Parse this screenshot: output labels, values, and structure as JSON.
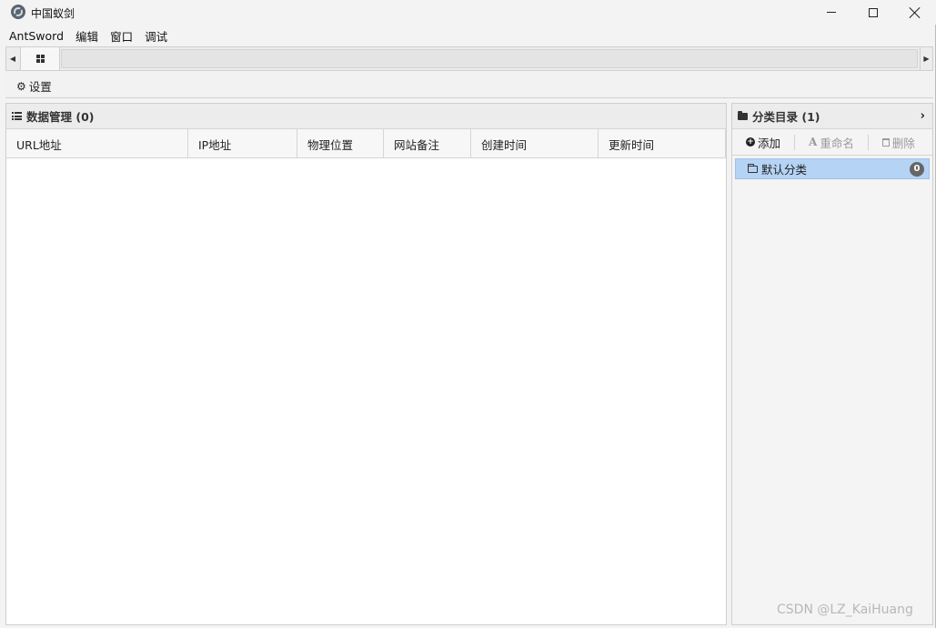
{
  "window": {
    "title": "中国蚁剑"
  },
  "menubar": {
    "items": [
      "AntSword",
      "编辑",
      "窗口",
      "调试"
    ]
  },
  "toolbar": {
    "settings_label": "设置"
  },
  "data_panel": {
    "title": "数据管理 (0)",
    "columns": [
      "URL地址",
      "IP地址",
      "物理位置",
      "网站备注",
      "创建时间",
      "更新时间"
    ],
    "rows": []
  },
  "category_panel": {
    "title": "分类目录 (1)",
    "actions": {
      "add": "添加",
      "rename": "重命名",
      "delete": "删除"
    },
    "items": [
      {
        "label": "默认分类",
        "count": "0"
      }
    ]
  },
  "watermark": "CSDN @LZ_KaiHuang"
}
